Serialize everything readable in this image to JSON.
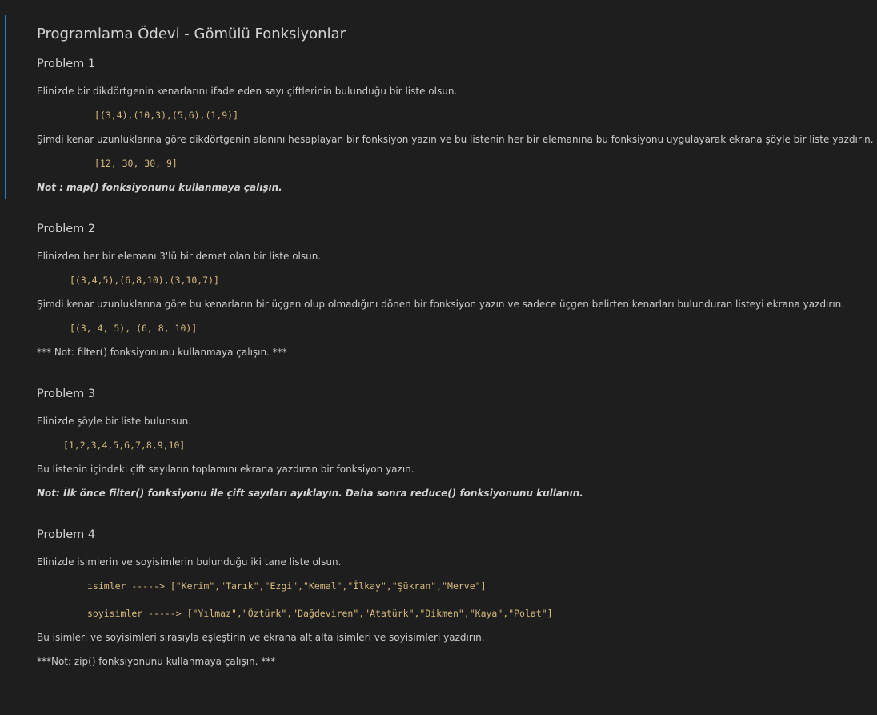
{
  "title": "Programlama Ödevi - Gömülü Fonksiyonlar",
  "problem1": {
    "heading": "Problem 1",
    "intro": "Elinizde bir dikdörtgenin kenarlarını ifade eden sayı çiftlerinin bulunduğu bir liste olsun.",
    "code_input": "[(3,4),(10,3),(5,6),(1,9)]",
    "task": "Şimdi kenar uzunluklarına göre dikdörtgenin alanını hesaplayan bir fonksiyon yazın ve bu listenin her bir elemanına bu fonksiyonu uygulayarak ekrana şöyle bir liste yazdırın.",
    "code_output": "[12, 30, 30, 9]",
    "note": "Not : map() fonksiyonunu kullanmaya çalışın."
  },
  "problem2": {
    "heading": "Problem 2",
    "intro": "Elinizden her bir elemanı 3'lü bir demet olan bir liste olsun.",
    "code_input": "[(3,4,5),(6,8,10),(3,10,7)]",
    "task": "Şimdi kenar uzunluklarına göre bu kenarların bir üçgen olup olmadığını dönen bir fonksiyon yazın ve sadece üçgen belirten kenarları bulunduran listeyi ekrana yazdırın.",
    "code_output": "[(3, 4, 5), (6, 8, 10)]",
    "note": "*** Not: filter() fonksiyonunu kullanmaya çalışın. ***"
  },
  "problem3": {
    "heading": "Problem 3",
    "intro": "Elinizde şöyle bir liste bulunsun.",
    "code_input": "[1,2,3,4,5,6,7,8,9,10]",
    "task": "Bu listenin içindeki çift sayıların toplamını ekrana yazdıran bir fonksiyon yazın.",
    "note": "Not: İlk önce filter() fonksiyonu ile çift sayıları ayıklayın. Daha sonra reduce() fonksiyonunu kullanın."
  },
  "problem4": {
    "heading": "Problem 4",
    "intro": "Elinizde isimlerin ve soyisimlerin bulunduğu iki tane liste olsun.",
    "code_names": "isimler -----> [\"Kerim\",\"Tarık\",\"Ezgi\",\"Kemal\",\"İlkay\",\"Şükran\",\"Merve\"]",
    "code_surnames": "soyisimler -----> [\"Yılmaz\",\"Öztürk\",\"Dağdeviren\",\"Atatürk\",\"Dikmen\",\"Kaya\",\"Polat\"]",
    "task": "Bu isimleri ve soyisimleri sırasıyla eşleştirin ve ekrana alt alta isimleri ve soyisimleri yazdırın.",
    "note": "***Not: zip() fonksiyonunu kullanmaya çalışın. ***"
  }
}
